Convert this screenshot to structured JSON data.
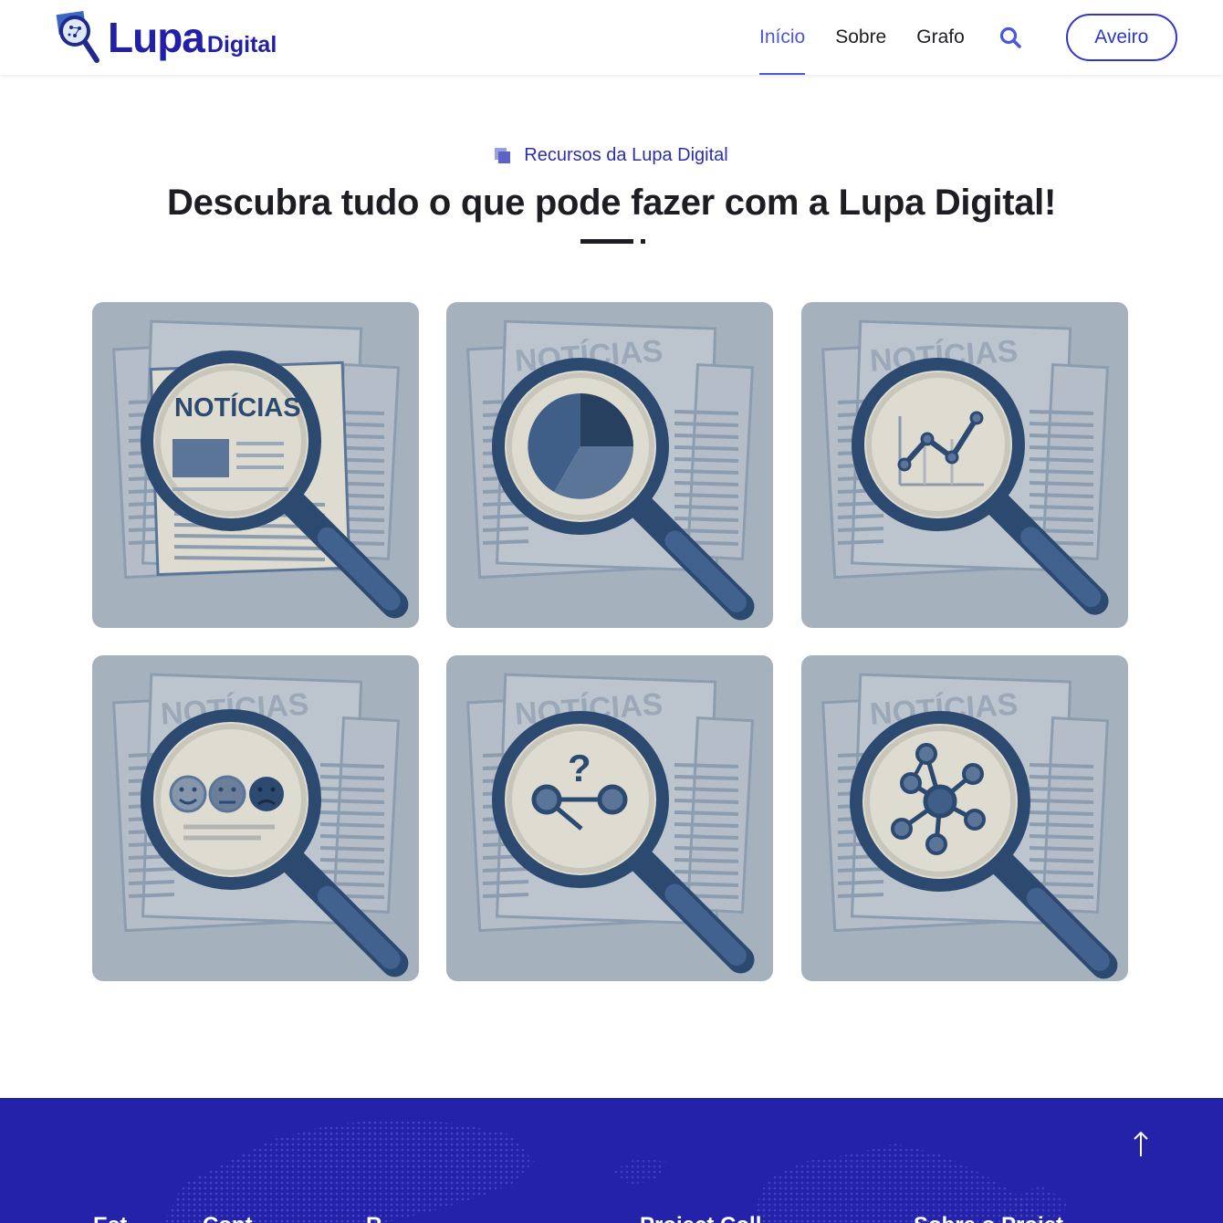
{
  "header": {
    "logo": {
      "lupa": "Lupa",
      "digital": "Digital"
    },
    "nav": [
      {
        "label": "Início",
        "active": true
      },
      {
        "label": "Sobre",
        "active": false
      },
      {
        "label": "Grafo",
        "active": false
      }
    ],
    "search_icon": "search-icon",
    "cta_label": "Aveiro"
  },
  "section": {
    "eyebrow": "Recursos da Lupa Digital",
    "title": "Descubra tudo o que pode fazer com a Lupa Digital!"
  },
  "cards": [
    {
      "icon": "newspaper-magnifier-icon",
      "paper_label": "NOTÍCIAS"
    },
    {
      "icon": "pie-chart-magnifier-icon",
      "paper_label": "NOTÍCIAS"
    },
    {
      "icon": "line-chart-magnifier-icon",
      "paper_label": "NOTÍCIAS"
    },
    {
      "icon": "sentiment-magnifier-icon",
      "paper_label": "NOTÍCIAS"
    },
    {
      "icon": "question-relation-magnifier-icon",
      "paper_label": "NOTÍCIAS"
    },
    {
      "icon": "network-graph-magnifier-icon",
      "paper_label": "NOTÍCIAS"
    }
  ],
  "footer": {
    "headings": [
      "Est",
      "Cont",
      "R",
      "Project Coll",
      "Sobre o Projet"
    ],
    "back_to_top_icon": "arrow-up-icon"
  },
  "colors": {
    "brand": "#2320a8",
    "accent": "#4a56e2",
    "footer_bg": "#2322a9",
    "card_bg": "#a6b1be",
    "illustration_dark": "#2c4a70"
  }
}
